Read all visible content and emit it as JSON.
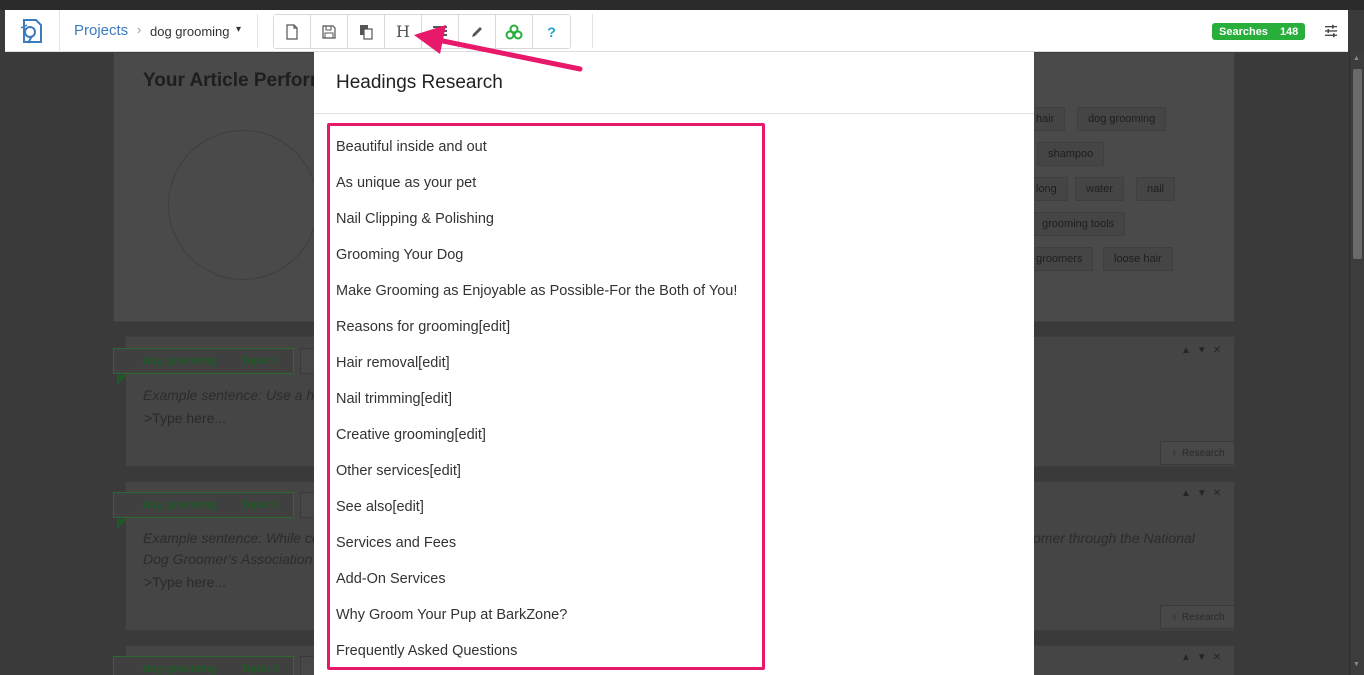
{
  "toolbar": {
    "breadcrumb_root": "Projects",
    "breadcrumb_sep": "›",
    "project_name": "dog grooming",
    "caret": "▾",
    "h_label": "H",
    "help_label": "?",
    "searches_label": "Searches",
    "searches_count": "148"
  },
  "background": {
    "title": "Your Article Perform",
    "keywords": [
      "hair",
      "dog grooming",
      "shampoo",
      "long",
      "water",
      "nail",
      "grooming tools",
      "groomers",
      "loose hair"
    ],
    "topics": [
      {
        "keyword": "dog grooming",
        "topic": "Topic 1",
        "example": "Example sentence: Use a hy",
        "example2": "",
        "example_right": "",
        "type_placeholder": ">Type here...",
        "research": "Research"
      },
      {
        "keyword": "dog grooming",
        "topic": "Topic 2",
        "example": "Example sentence: While co",
        "example2": "Dog Groomer's Association o",
        "example_right": "omer through the National",
        "type_placeholder": ">Type here...",
        "research": "Research"
      },
      {
        "keyword": "dog grooming",
        "topic": "Topic 3"
      }
    ],
    "card_controls": "▲▼✕"
  },
  "modal": {
    "title": "Headings Research",
    "headings": [
      "Beautiful inside and out",
      "As unique as your pet",
      "Nail Clipping & Polishing",
      "Grooming Your Dog",
      "Make Grooming as Enjoyable as Possible-For the Both of You!",
      "Reasons for grooming[edit]",
      "Hair removal[edit]",
      "Nail trimming[edit]",
      "Creative grooming[edit]",
      "Other services[edit]",
      "See also[edit]",
      "Services and Fees",
      "Add-On Services",
      "Why Groom Your Pup at BarkZone?",
      "Frequently Asked Questions"
    ]
  },
  "colors": {
    "accent_green": "#27ae3b",
    "link_blue": "#3b7bbf",
    "highlight_pink": "#e8196b"
  }
}
